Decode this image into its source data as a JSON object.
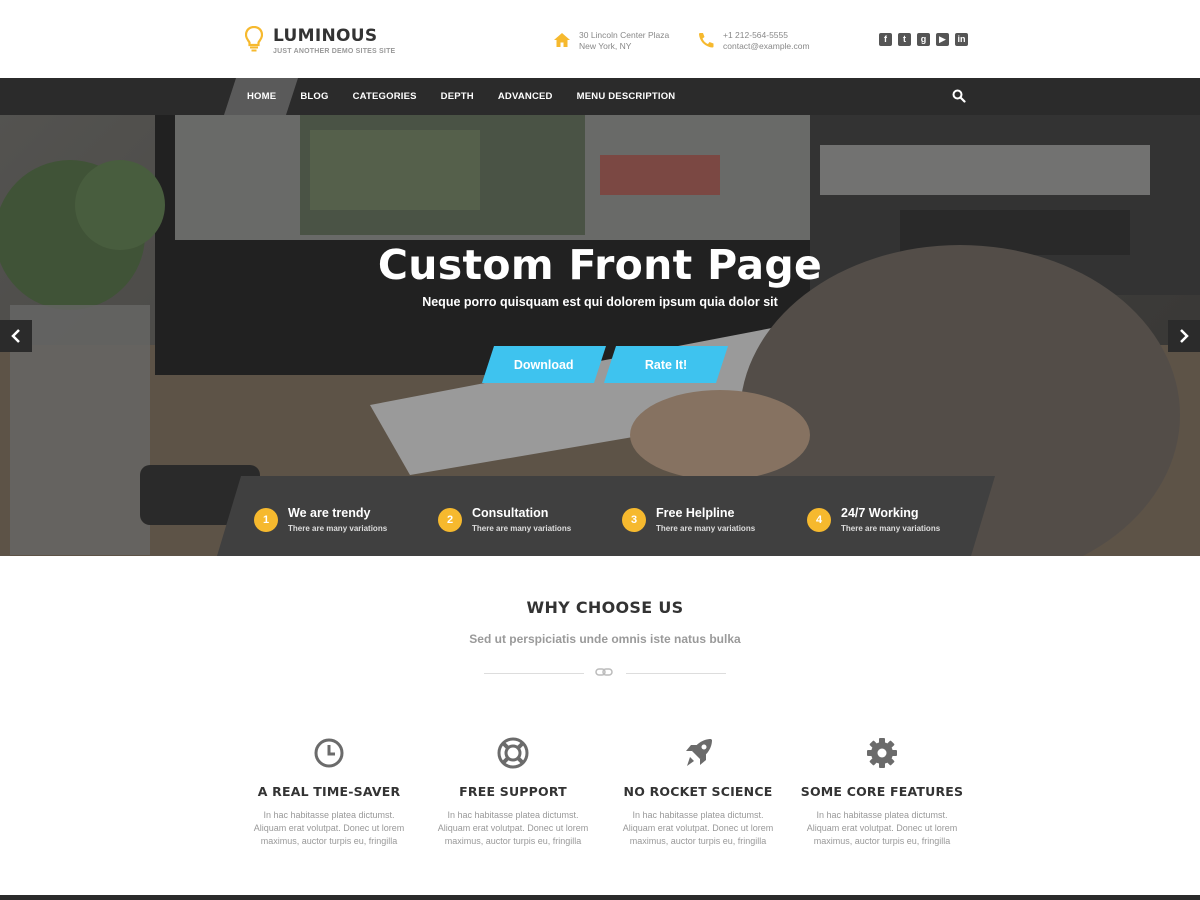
{
  "brand": {
    "title": "LUMINOUS",
    "tagline": "JUST ANOTHER DEMO SITES SITE",
    "accent": "#f6b92e"
  },
  "contact": {
    "address_line1": "30 Lincoln Center Plaza",
    "address_line2": "New York, NY",
    "phone": "+1 212-564-5555",
    "email": "contact@example.com"
  },
  "social": [
    "facebook-icon",
    "twitter-icon",
    "google-plus-icon",
    "youtube-icon",
    "linkedin-icon"
  ],
  "nav": {
    "items": [
      "HOME",
      "BLOG",
      "CATEGORIES",
      "DEPTH",
      "ADVANCED",
      "MENU DESCRIPTION"
    ],
    "active": "HOME"
  },
  "hero": {
    "title": "Custom Front Page",
    "subtitle": "Neque porro quisquam est qui dolorem ipsum quia dolor sit",
    "buttons": [
      "Download",
      "Rate It!"
    ],
    "button_color": "#3ec3ef"
  },
  "features": [
    {
      "num": "1",
      "title": "We are trendy",
      "sub": "There are many variations"
    },
    {
      "num": "2",
      "title": "Consultation",
      "sub": "There are many variations"
    },
    {
      "num": "3",
      "title": "Free Helpline",
      "sub": "There are many variations"
    },
    {
      "num": "4",
      "title": "24/7 Working",
      "sub": "There are many variations"
    }
  ],
  "why": {
    "title": "WHY CHOOSE US",
    "subtitle": "Sed ut perspiciatis unde omnis iste natus bulka",
    "columns": [
      {
        "icon": "clock-icon",
        "heading": "A REAL TIME-SAVER",
        "l1": "In hac habitasse platea dictumst.",
        "l2": "Aliquam erat volutpat. Donec ut lorem",
        "l3": "maximus, auctor turpis eu, fringilla"
      },
      {
        "icon": "lifebuoy-icon",
        "heading": "FREE SUPPORT",
        "l1": "In hac habitasse platea dictumst.",
        "l2": "Aliquam erat volutpat. Donec ut lorem",
        "l3": "maximus, auctor turpis eu, fringilla"
      },
      {
        "icon": "rocket-icon",
        "heading": "NO ROCKET SCIENCE",
        "l1": "In hac habitasse platea dictumst.",
        "l2": "Aliquam erat volutpat. Donec ut lorem",
        "l3": "maximus, auctor turpis eu, fringilla"
      },
      {
        "icon": "gear-icon",
        "heading": "SOME CORE FEATURES",
        "l1": "In hac habitasse platea dictumst.",
        "l2": "Aliquam erat volutpat. Donec ut lorem",
        "l3": "maximus, auctor turpis eu, fringilla"
      }
    ]
  }
}
